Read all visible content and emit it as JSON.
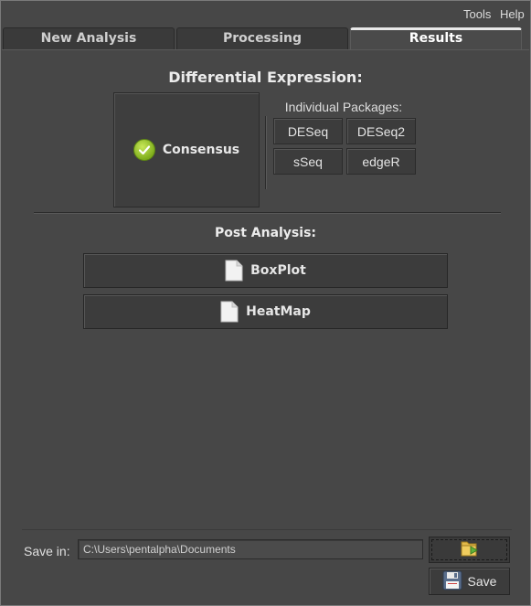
{
  "menu": {
    "tools": "Tools",
    "help": "Help"
  },
  "tabs": [
    {
      "label": "New Analysis",
      "active": false
    },
    {
      "label": "Processing",
      "active": false
    },
    {
      "label": "Results",
      "active": true
    }
  ],
  "results": {
    "de_heading": "Differential Expression:",
    "consensus": {
      "label": "Consensus",
      "icon": "check-circle-icon",
      "selected": true
    },
    "packages_label": "Individual Packages:",
    "packages": [
      "DESeq",
      "DESeq2",
      "sSeq",
      "edgeR"
    ],
    "post_heading": "Post Analysis:",
    "post_buttons": [
      {
        "label": "BoxPlot",
        "icon": "document-icon"
      },
      {
        "label": "HeatMap",
        "icon": "document-icon"
      }
    ]
  },
  "save": {
    "label": "Save in:",
    "path": "C:\\Users\\pentalpha\\Documents",
    "browse_icon": "folder-icon",
    "button_label": "Save",
    "button_icon": "floppy-disk-icon"
  },
  "colors": {
    "background": "#474747",
    "button": "#3c3c3c",
    "check_green": "#7fae1c",
    "text": "#e6e6e6"
  }
}
